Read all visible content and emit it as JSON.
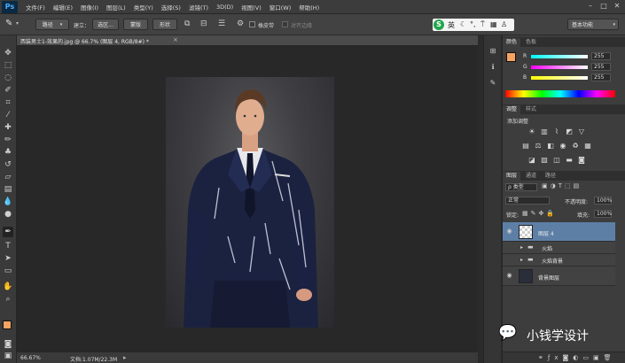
{
  "app": {
    "logo": "Ps"
  },
  "menu": [
    "文件(F)",
    "编辑(E)",
    "图像(I)",
    "图层(L)",
    "类型(Y)",
    "选择(S)",
    "滤镜(T)",
    "3D(D)",
    "视图(V)",
    "窗口(W)",
    "帮助(H)"
  ],
  "options": {
    "mode_value": "路径",
    "create_label": "建立：",
    "selection_button": "选区...",
    "mask_button": "蒙版",
    "shape_button": "形状",
    "rubber_band_label": "橡皮带",
    "align_edges_label": "对齐边缘",
    "workspace": "基本功能",
    "ime_label": "英"
  },
  "document": {
    "tab_label": "西装男士1-效果的.jpg @ 66.7% (图层 4, RGB/8#) *",
    "zoom": "66.67%",
    "doc_size": "文档:1.07M/22.3M"
  },
  "color_panel": {
    "tabs": [
      "颜色",
      "色板"
    ],
    "r_label": "R",
    "g_label": "G",
    "b_label": "B",
    "r_value": "255",
    "g_value": "255",
    "b_value": "255"
  },
  "adjust_panel": {
    "tabs": [
      "调整",
      "样式"
    ],
    "title": "添加调整"
  },
  "layers_panel": {
    "tabs": [
      "图层",
      "通道",
      "路径"
    ],
    "kind_filter": "ρ 类型",
    "blend_mode": "正常",
    "opacity_label": "不透明度:",
    "opacity_value": "100%",
    "lock_label": "锁定:",
    "fill_label": "填充:",
    "fill_value": "100%",
    "layers": [
      {
        "name": "图层 4",
        "selected": true
      },
      {
        "name": "火焰",
        "selected": false
      },
      {
        "name": "火焰背景",
        "selected": false
      },
      {
        "name": "背景图层",
        "selected": false
      }
    ]
  },
  "watermark": {
    "text": "小钱学设计"
  },
  "colors": {
    "accent": "#3f80c9",
    "fg_swatch": "#f5a462",
    "selected_layer": "#5d7fa6"
  }
}
